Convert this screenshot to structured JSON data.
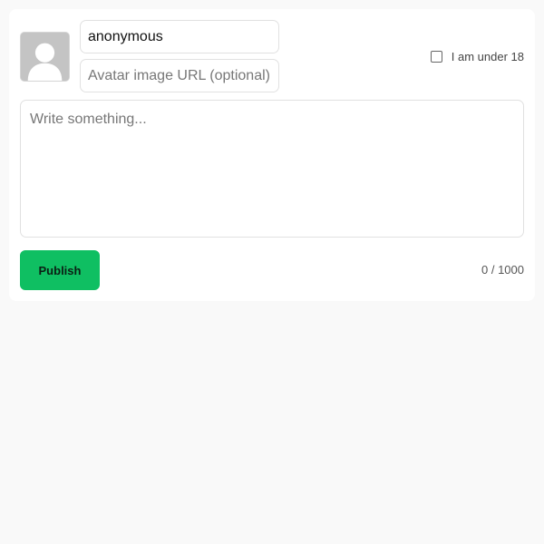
{
  "composer": {
    "avatar_icon": "default-user-avatar",
    "name_value": "anonymous",
    "avatar_url_placeholder": "Avatar image URL (optional)",
    "avatar_url_value": "",
    "under18_label": "I am under 18",
    "under18_checked": false,
    "message_placeholder": "Write something...",
    "message_value": "",
    "publish_label": "Publish",
    "char_count": "0 / 1000"
  },
  "colors": {
    "page_background": "#f9f9f9",
    "card_background": "#ffffff",
    "publish_button": "#0fbf62",
    "avatar_placeholder": "#c4c4c4"
  }
}
